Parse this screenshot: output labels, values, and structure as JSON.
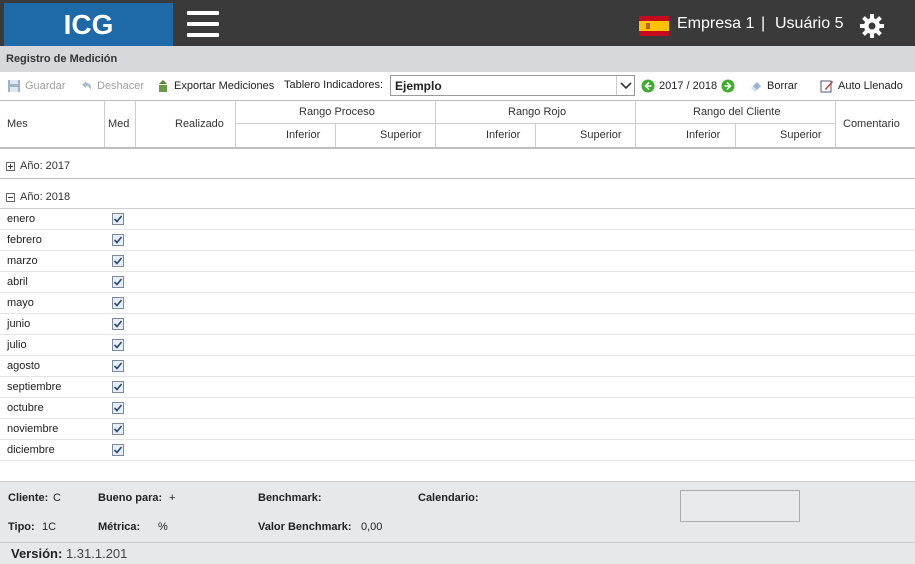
{
  "header": {
    "logo": "ICG",
    "company": "Empresa 1",
    "separator": "|",
    "user": "Usuário 5"
  },
  "section": {
    "title": "Registro de Medición"
  },
  "toolbar": {
    "guardar": "Guardar",
    "deshacer": "Deshacer",
    "exportar": "Exportar Mediciones",
    "tablero_label": "Tablero Indicadores:",
    "tablero_value": "Ejemplo",
    "period": "2017 / 2018",
    "borrar": "Borrar",
    "auto_llenado": "Auto Llenado"
  },
  "grid": {
    "columns": {
      "mes": "Mes",
      "med": "Med",
      "realizado": "Realizado",
      "rango_proceso": "Rango Proceso",
      "rango_rojo": "Rango Rojo",
      "rango_cliente": "Rango del Cliente",
      "comentario": "Comentario",
      "inferior": "Inferior",
      "superior": "Superior"
    },
    "groups": [
      {
        "label": "Año: 2017",
        "expanded": false
      },
      {
        "label": "Año: 2018",
        "expanded": true
      }
    ],
    "months": [
      "enero",
      "febrero",
      "marzo",
      "abril",
      "mayo",
      "junio",
      "julio",
      "agosto",
      "septiembre",
      "octubre",
      "noviembre",
      "diciembre"
    ],
    "checked": true
  },
  "footer": {
    "cliente_label": "Cliente:",
    "cliente_value": "C",
    "bueno_label": "Bueno para:",
    "bueno_value": "+",
    "benchmark_label": "Benchmark:",
    "calendario_label": "Calendario:",
    "tipo_label": "Tipo:",
    "tipo_value": "1C",
    "metrica_label": "Métrica:",
    "metrica_value": "%",
    "valor_benchmark_label": "Valor Benchmark:",
    "valor_benchmark_value": "0,00"
  },
  "version": {
    "label": "Versión",
    "value": "1.31.1.201"
  },
  "colors": {
    "logo_bg": "#1e6aa8",
    "topbar_bg": "#3a3a3a",
    "accent_green": "#3cae2c"
  }
}
